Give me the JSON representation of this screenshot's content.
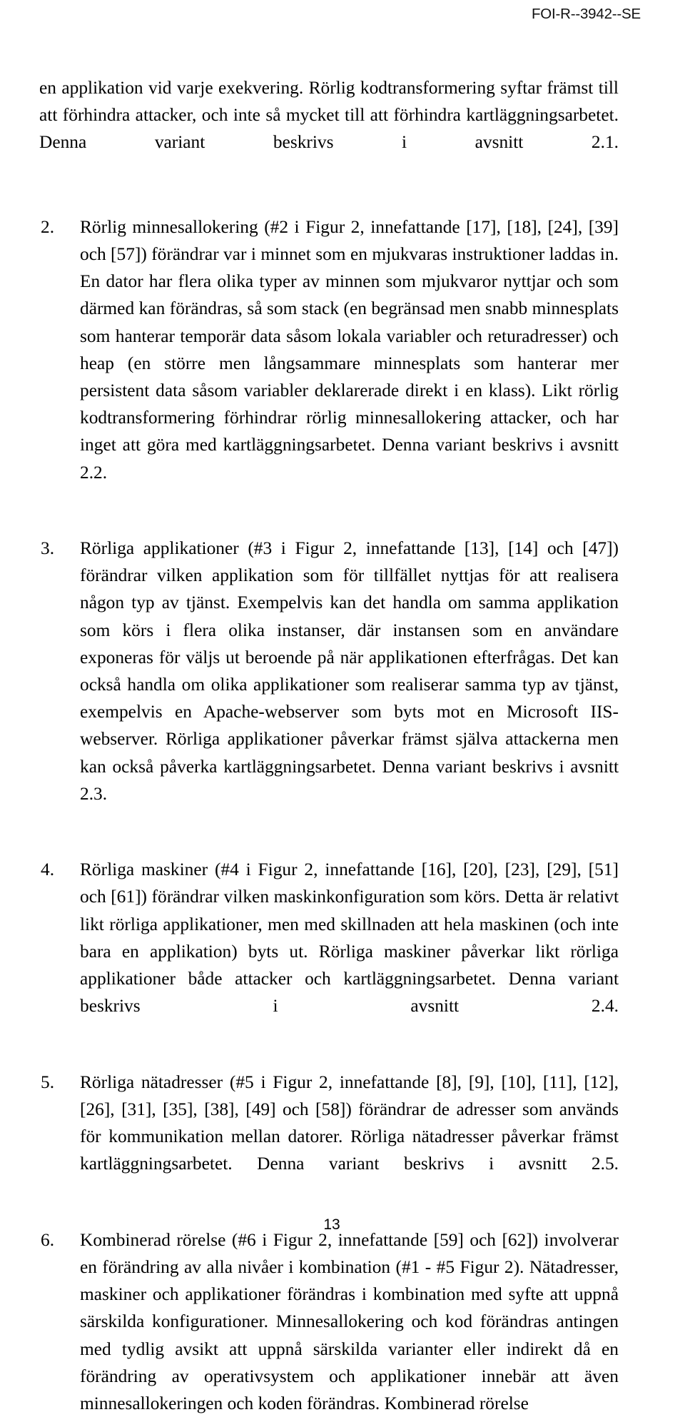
{
  "header": {
    "report_id": "FOI-R--3942--SE"
  },
  "footer": {
    "page_number": "13"
  },
  "page": {
    "intro_paragraph": "en applikation vid varje exekvering. Rörlig kodtransformering syftar främst till att förhindra attacker, och inte så mycket till att förhindra kartläggningsarbetet. Denna variant beskrivs i avsnitt 2.1.",
    "items": [
      {
        "marker": "2.",
        "text": "Rörlig minnesallokering (#2 i Figur 2, innefattande [17], [18], [24], [39] och [57]) förändrar var i minnet som en mjukvaras instruktioner laddas in. En dator har flera olika typer av minnen som mjukvaror nyttjar och som därmed kan förändras, så som stack (en begränsad men snabb minnesplats som hanterar temporär data såsom lokala variabler och returadresser) och heap (en större men långsammare minnesplats som hanterar mer persistent data såsom variabler deklarerade direkt i en klass). Likt rörlig kodtransformering förhindrar rörlig minnesallokering attacker, och har inget att göra med kartläggningsarbetet. Denna variant beskrivs i avsnitt 2.2."
      },
      {
        "marker": "3.",
        "text": "Rörliga applikationer (#3 i Figur 2, innefattande [13], [14] och [47]) förändrar vilken applikation som för tillfället nyttjas för att realisera någon typ av tjänst. Exempelvis kan det handla om samma applikation som körs i flera olika instanser, där instansen som en användare exponeras för väljs ut beroende på när applikationen efterfrågas. Det kan också handla om olika applikationer som realiserar samma typ av tjänst, exempelvis en Apache-webserver som byts mot en Microsoft IIS-webserver. Rörliga applikationer påverkar främst själva attackerna men kan också påverka kartläggningsarbetet. Denna variant beskrivs i avsnitt 2.3."
      },
      {
        "marker": "4.",
        "text": "Rörliga maskiner (#4 i Figur 2, innefattande [16], [20], [23], [29], [51] och [61]) förändrar vilken maskinkonfiguration som körs. Detta är relativt likt rörliga applikationer, men med skillnaden att hela maskinen (och inte bara en applikation) byts ut. Rörliga maskiner påverkar likt rörliga applikationer både attacker och kartläggningsarbetet. Denna variant beskrivs i avsnitt 2.4."
      },
      {
        "marker": "5.",
        "text": "Rörliga nätadresser (#5 i Figur 2, innefattande [8], [9], [10], [11], [12], [26], [31], [35], [38], [49] och [58]) förändrar de adresser som används för kommunikation mellan datorer. Rörliga nätadresser påverkar främst kartläggningsarbetet. Denna variant beskrivs i avsnitt 2.5."
      },
      {
        "marker": "6.",
        "text": "Kombinerad rörelse (#6 i Figur 2, innefattande [59] och [62]) involverar en förändring av alla nivåer i kombination (#1 - #5 Figur 2). Nätadresser, maskiner och applikationer förändras i kombination med syfte att uppnå särskilda konfigurationer. Minnesallokering och kod förändras antingen med tydlig avsikt att uppnå särskilda varianter eller indirekt då en förändring av operativsystem och applikationer innebär att även minnesallokeringen och koden förändras. Kombinerad rörelse"
      }
    ]
  }
}
